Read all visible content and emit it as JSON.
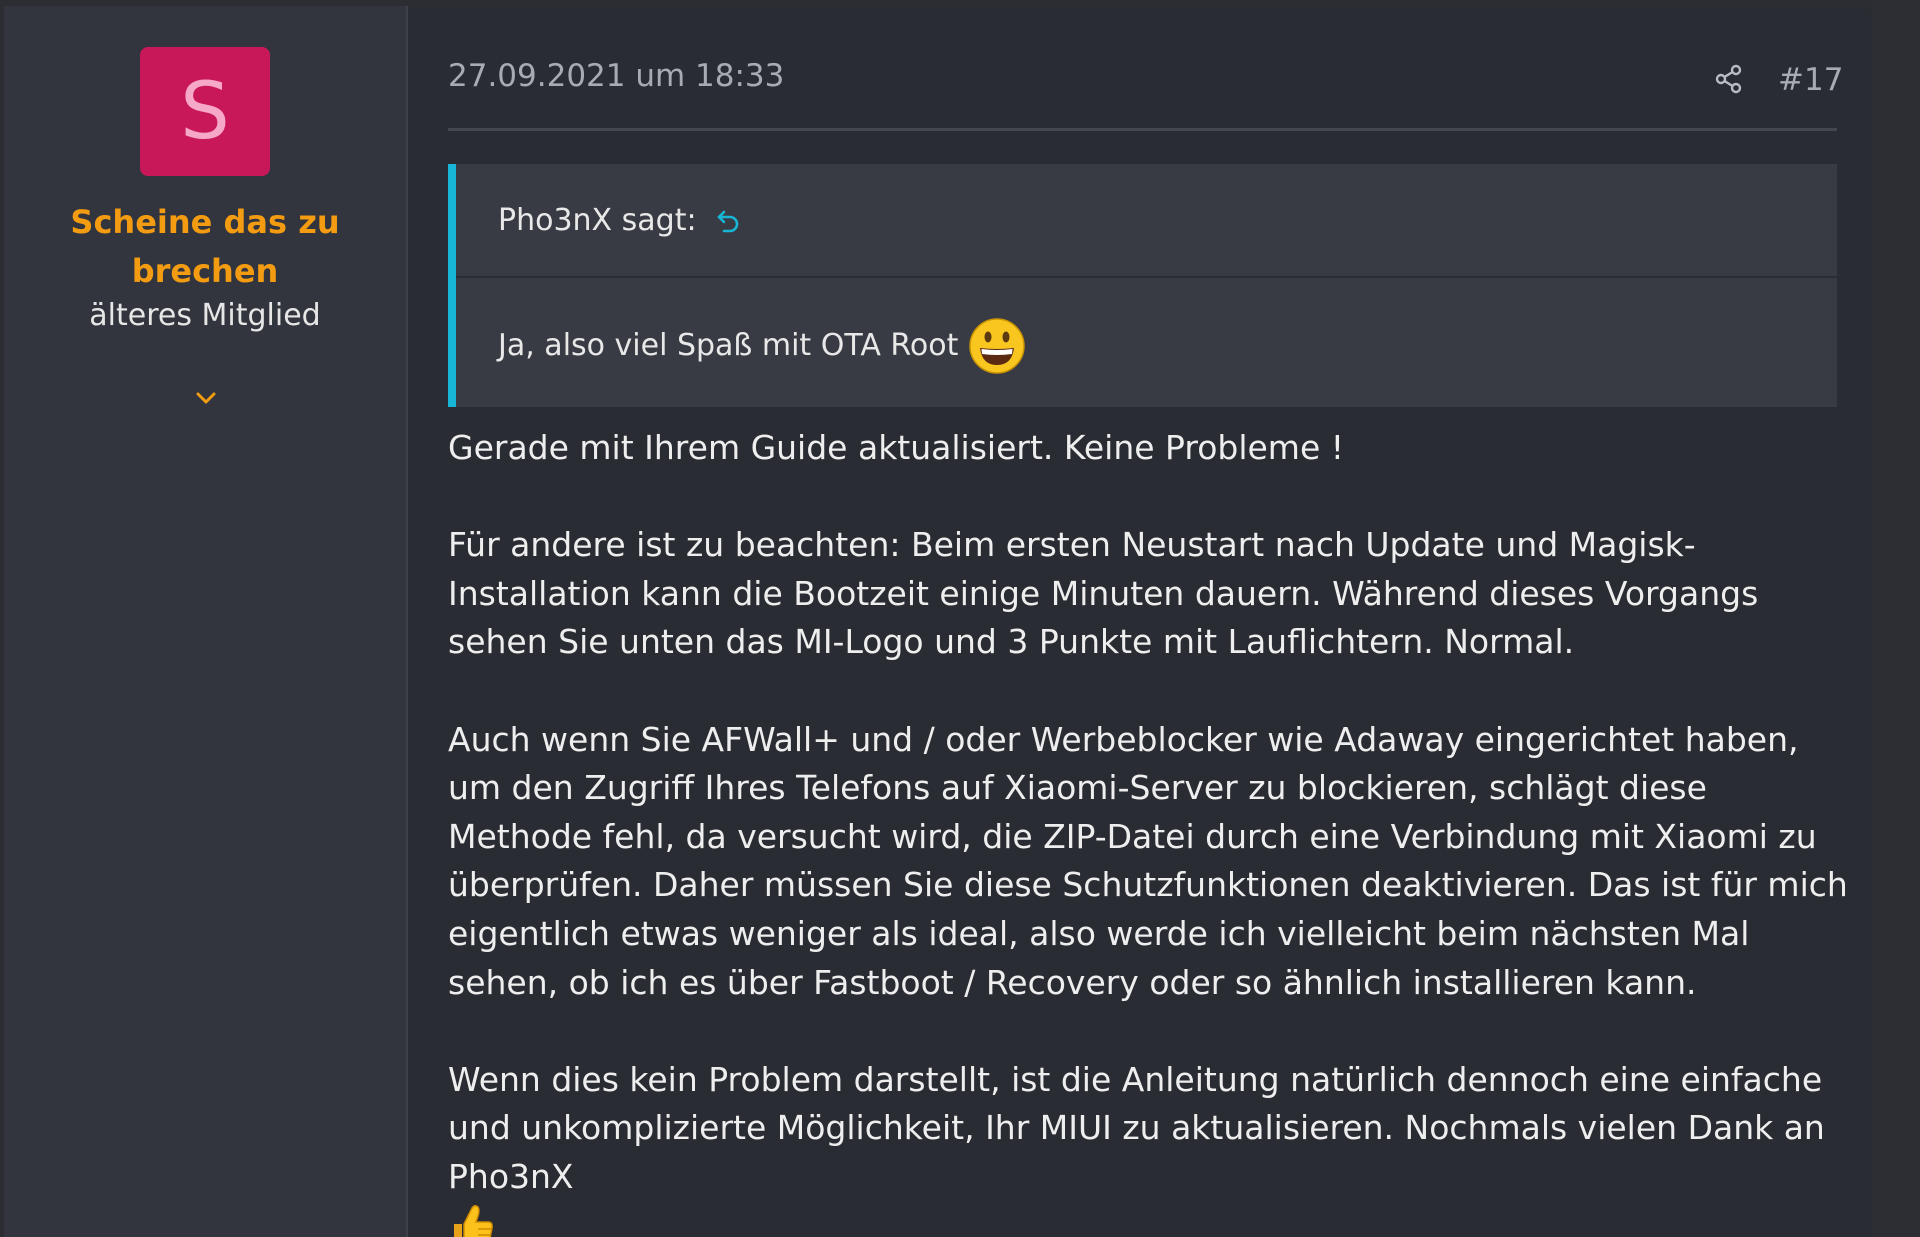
{
  "author": {
    "avatar_letter": "S",
    "name_line1": "Scheine das zu",
    "name_line2": "brechen",
    "title": "älteres Mitglied"
  },
  "post": {
    "date": "27.09.2021 um 18:33",
    "number": "#17"
  },
  "quote": {
    "attribution": "Pho3nX sagt:",
    "text": "Ja, also viel Spaß mit OTA Root"
  },
  "body": {
    "p1": "Gerade mit Ihrem Guide aktualisiert. Keine Probleme !",
    "p2": "Für andere ist zu beachten: Beim ersten Neustart nach Update und Magisk-Installation kann die Bootzeit einige Minuten dauern. Während dieses Vorgangs sehen Sie unten das MI-Logo und 3 Punkte mit Lauflichtern. Normal.",
    "p3": "Auch wenn Sie AFWall+ und / oder Werbeblocker wie Adaway eingerichtet haben, um den Zugriff Ihres Telefons auf Xiaomi-Server zu blockieren, schlägt diese Methode fehl, da versucht wird, die ZIP-Datei durch eine Verbindung mit Xiaomi zu überprüfen. Daher müssen Sie diese Schutzfunktionen deaktivieren. Das ist für mich eigentlich etwas weniger als ideal, also werde ich vielleicht beim nächsten Mal sehen, ob ich es über Fastboot / Recovery oder so ähnlich installieren kann.",
    "p4": "Wenn dies kein Problem darstellt, ist die Anleitung natürlich dennoch eine einfache und unkomplizierte Möglichkeit, Ihr MIUI zu aktualisieren. Nochmals vielen Dank an Pho3nX"
  },
  "colors": {
    "accent": "#17b6d6",
    "username": "#f39c12",
    "avatar_bg": "#c8185a"
  },
  "icons": {
    "share": "share-icon",
    "quote_jump": "return-arrow-icon",
    "expand": "chevron-down-icon",
    "quote_emoji": "grinning-face-icon",
    "body_emoji": "thumbs-up-icon"
  }
}
